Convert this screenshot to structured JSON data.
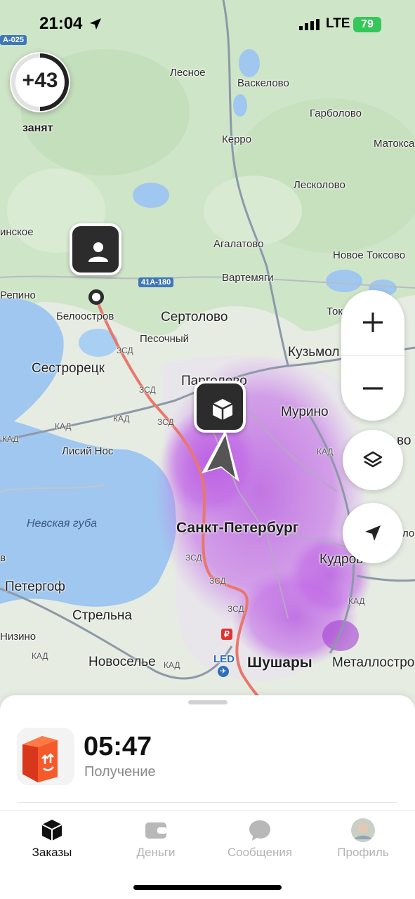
{
  "status_bar": {
    "time": "21:04",
    "network": "LTE",
    "battery": "79"
  },
  "busy_counter": {
    "value": "+43",
    "label": "занят"
  },
  "map": {
    "places": {
      "lesnoe": "Лесное",
      "vaskelovo": "Васкелово",
      "garbolovo": "Гарболово",
      "kerro": "Керро",
      "matoksa": "Матокса",
      "leskolovo": "Лесколово",
      "nskoe": "инское",
      "agalatovo": "Агалатово",
      "novoe_toksovo": "Новое Токсово",
      "vartemyagi": "Вартемяги",
      "repino": "Репино",
      "beloostrov": "Белоостров",
      "sertolovo": "Сертолово",
      "tok": "Ток",
      "pesochny": "Песочный",
      "kuzmolovsky": "Кузьмол",
      "sestroretsk": "Сестрорецк",
      "pargolovo": "Парголово",
      "murino": "Мурино",
      "lisy_nos": "Лисий Нос",
      "vo": "во",
      "nevskaya_guba": "Невская губа",
      "spb": "Санкт-Петербург",
      "kudrovo": "Кудров",
      "peterhof": "Петергоф",
      "strelna": "Стрельна",
      "nizino": "Низино",
      "novoselye": "Новоселье",
      "shushary": "Шушары",
      "metallostroy": "Металлостро",
      "led": "LED",
      "edge_v": "в",
      "edge_lo": "ло"
    },
    "road_shields": {
      "a025": "А-025",
      "a41": "41А-180"
    },
    "road_labels": {
      "kad": "КАД",
      "zsd": "ЗСД"
    }
  },
  "bottom_sheet": {
    "order": {
      "timer": "05:47",
      "status": "Получение"
    }
  },
  "tabs": [
    {
      "label": "Заказы"
    },
    {
      "label": "Деньги"
    },
    {
      "label": "Сообщения"
    },
    {
      "label": "Профиль"
    }
  ],
  "colors": {
    "heatmap": "#b44fe0",
    "water": "#9fc7ef",
    "accent": "#111111",
    "order_box": "#f1461f",
    "battery": "#35c759"
  }
}
